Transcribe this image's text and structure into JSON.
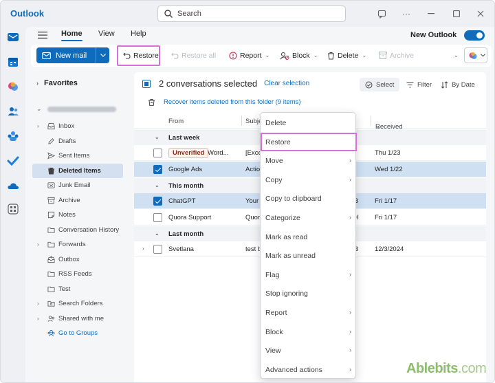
{
  "app": {
    "title": "Outlook"
  },
  "search": {
    "placeholder": "Search"
  },
  "tabs": [
    {
      "label": "Home",
      "active": true
    },
    {
      "label": "View",
      "active": false
    },
    {
      "label": "Help",
      "active": false
    }
  ],
  "new_outlook": {
    "label": "New Outlook",
    "enabled": true
  },
  "toolbar": {
    "new_mail": "New mail",
    "restore": "Restore",
    "restore_all": "Restore all",
    "report": "Report",
    "block": "Block",
    "delete": "Delete",
    "archive": "Archive"
  },
  "folders": {
    "favorites": "Favorites",
    "items": [
      {
        "label": "Inbox",
        "icon": "inbox-icon",
        "expandable": true
      },
      {
        "label": "Drafts",
        "icon": "pencil-icon",
        "expandable": false
      },
      {
        "label": "Sent Items",
        "icon": "send-icon",
        "expandable": false
      },
      {
        "label": "Deleted Items",
        "icon": "trash-icon",
        "expandable": false,
        "selected": true
      },
      {
        "label": "Junk Email",
        "icon": "junk-icon",
        "expandable": false
      },
      {
        "label": "Archive",
        "icon": "archive-icon",
        "expandable": false
      },
      {
        "label": "Notes",
        "icon": "note-icon",
        "expandable": false
      },
      {
        "label": "Conversation History",
        "icon": "folder-icon",
        "expandable": false
      },
      {
        "label": "Forwards",
        "icon": "folder-icon",
        "expandable": true
      },
      {
        "label": "Outbox",
        "icon": "outbox-icon",
        "expandable": false
      },
      {
        "label": "RSS Feeds",
        "icon": "folder-icon",
        "expandable": false
      },
      {
        "label": "Test",
        "icon": "folder-icon",
        "expandable": false
      },
      {
        "label": "Search Folders",
        "icon": "search-folder-icon",
        "expandable": true
      },
      {
        "label": "Shared with me",
        "icon": "shared-icon",
        "expandable": true
      },
      {
        "label": "Go to Groups",
        "icon": "groups-icon",
        "expandable": false,
        "link": true
      }
    ]
  },
  "list": {
    "selected_count": "2 conversations selected",
    "clear_selection": "Clear selection",
    "select": "Select",
    "filter": "Filter",
    "sort": "By Date",
    "recover": "Recover items deleted from this folder (9 items)",
    "columns": {
      "from": "From",
      "subject": "Subje",
      "received": "Received"
    },
    "groups": {
      "last_week": "Last week",
      "this_month": "This month",
      "last_month": "Last month"
    },
    "rows": [
      {
        "badge": "Unverified",
        "from": "Word...",
        "subject": "[Exce",
        "size": "",
        "received": "Thu 1/23",
        "checked": false
      },
      {
        "from": "Google Ads",
        "subject": "Action",
        "size": "",
        "received": "Wed 1/22",
        "checked": true
      },
      {
        "from": "ChatGPT",
        "subject": "Your",
        "size": "B",
        "received": "Fri 1/17",
        "checked": true
      },
      {
        "from": "Quora Support",
        "subject": "Quor",
        "size": "H",
        "received": "Fri 1/17",
        "checked": false
      },
      {
        "from": "Svetlana",
        "subject": "test b",
        "size": "B",
        "received": "12/3/2024",
        "checked": false
      }
    ]
  },
  "context_menu": [
    {
      "label": "Delete",
      "submenu": false
    },
    {
      "label": "Restore",
      "submenu": false,
      "highlighted": true
    },
    {
      "label": "Move",
      "submenu": true
    },
    {
      "label": "Copy",
      "submenu": true
    },
    {
      "label": "Copy to clipboard",
      "submenu": false
    },
    {
      "label": "Categorize",
      "submenu": true
    },
    {
      "label": "Mark as read",
      "submenu": false
    },
    {
      "label": "Mark as unread",
      "submenu": false
    },
    {
      "label": "Flag",
      "submenu": true
    },
    {
      "label": "Stop ignoring",
      "submenu": false
    },
    {
      "label": "Report",
      "submenu": true
    },
    {
      "label": "Block",
      "submenu": true
    },
    {
      "label": "View",
      "submenu": true
    },
    {
      "label": "Advanced actions",
      "submenu": true
    }
  ],
  "watermark": {
    "brand": "Ablebits",
    "suffix": ".com"
  },
  "colors": {
    "accent": "#0f6cbd",
    "highlight": "#d66fd8",
    "selected_row": "#cfe0f3"
  }
}
